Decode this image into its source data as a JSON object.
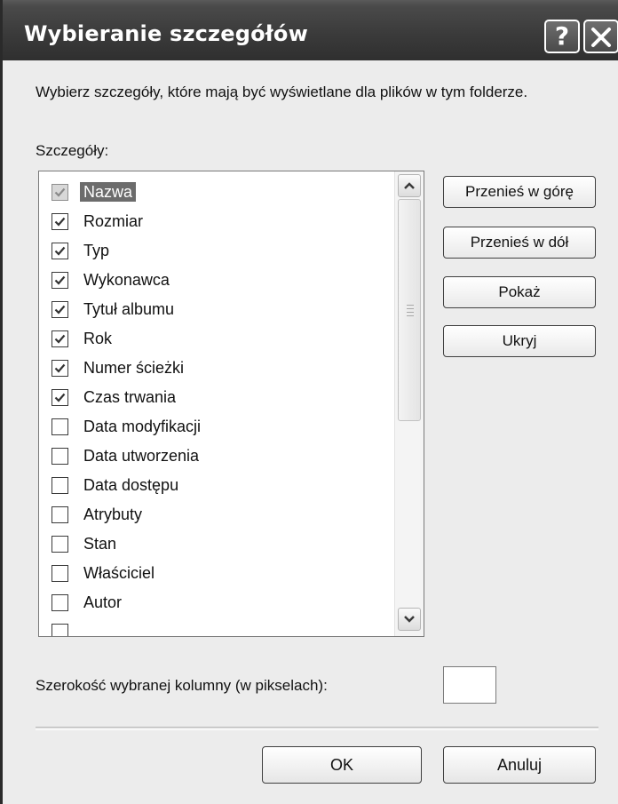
{
  "window": {
    "title": "Wybieranie szczegółów",
    "help_label": "?"
  },
  "description": "Wybierz szczegóły, które mają być wyświetlane dla plików w tym folderze.",
  "details_label": "Szczegóły:",
  "details": [
    {
      "label": "Nazwa",
      "checked": true,
      "disabled": true,
      "selected": true
    },
    {
      "label": "Rozmiar",
      "checked": true
    },
    {
      "label": "Typ",
      "checked": true
    },
    {
      "label": "Wykonawca",
      "checked": true
    },
    {
      "label": "Tytuł albumu",
      "checked": true
    },
    {
      "label": "Rok",
      "checked": true
    },
    {
      "label": "Numer ścieżki",
      "checked": true
    },
    {
      "label": "Czas trwania",
      "checked": true
    },
    {
      "label": "Data modyfikacji",
      "checked": false
    },
    {
      "label": "Data utworzenia",
      "checked": false
    },
    {
      "label": "Data dostępu",
      "checked": false
    },
    {
      "label": "Atrybuty",
      "checked": false
    },
    {
      "label": "Stan",
      "checked": false
    },
    {
      "label": "Właściciel",
      "checked": false
    },
    {
      "label": "Autor",
      "checked": false
    }
  ],
  "buttons": {
    "move_up": "Przenieś w górę",
    "move_down": "Przenieś w dół",
    "show": "Pokaż",
    "hide": "Ukryj",
    "ok": "OK",
    "cancel": "Anuluj"
  },
  "column_width": {
    "label": "Szerokość wybranej kolumny (w pikselach):",
    "value": ""
  }
}
